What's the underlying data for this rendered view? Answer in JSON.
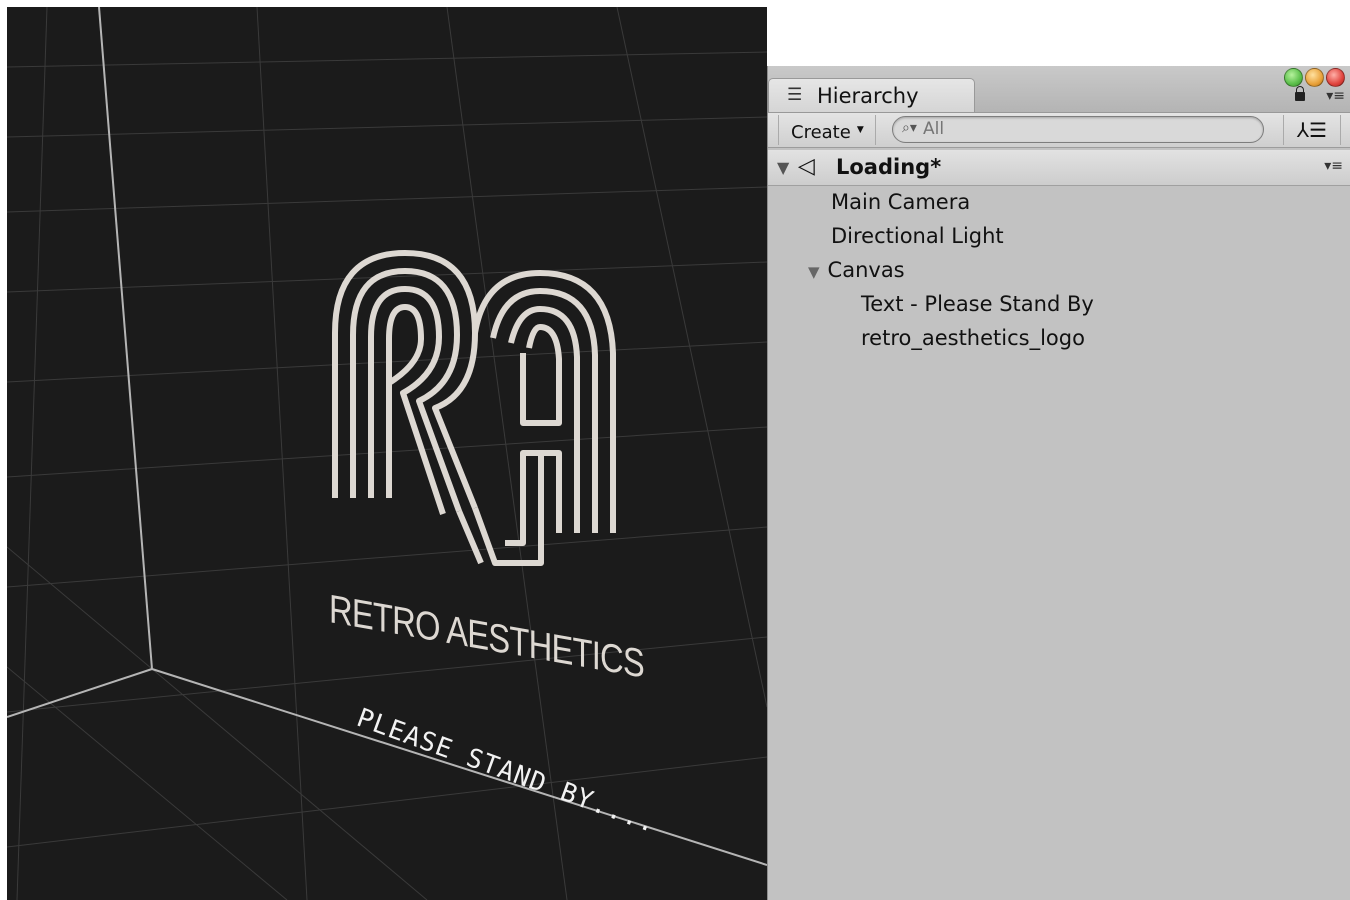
{
  "scene": {
    "logo_monogram": "RA",
    "logo_text": "RETRO AESTHETICS",
    "standby_text": "PLEASE STAND BY...."
  },
  "hierarchy": {
    "tab_label": "Hierarchy",
    "create_label": "Create",
    "search_placeholder": "All",
    "scene_name": "Loading*",
    "items": [
      {
        "label": "Main Camera"
      },
      {
        "label": "Directional Light"
      },
      {
        "label": "Canvas"
      },
      {
        "label": "Text - Please Stand By"
      },
      {
        "label": "retro_aesthetics_logo"
      }
    ]
  },
  "colors": {
    "scene_bg": "#1b1b1b",
    "panel_bg": "#c2c2c2",
    "logo": "#ddd8d2",
    "close_button": "#e0443e",
    "minimize_button": "#e9a23b",
    "zoom_button": "#5bbf4a"
  },
  "icons": [
    "hierarchy-list-icon",
    "lock-icon",
    "panel-menu-icon",
    "search-icon",
    "hierarchy-filter-icon",
    "unity-scene-icon",
    "foldout-triangle-icon"
  ]
}
